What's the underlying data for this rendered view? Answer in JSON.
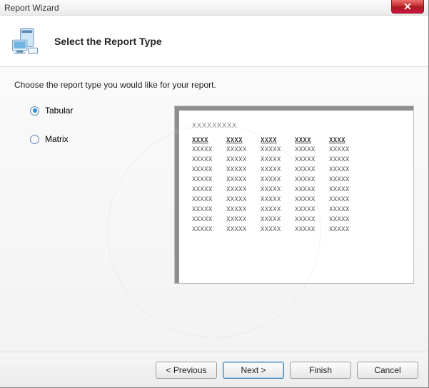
{
  "window": {
    "title": "Report Wizard"
  },
  "header": {
    "title": "Select the Report Type"
  },
  "content": {
    "prompt": "Choose the report type you would like for your report.",
    "options": {
      "tabular": "Tabular",
      "matrix": "Matrix",
      "selected": "tabular"
    },
    "preview": {
      "title": "XXXXXXXXX",
      "columns": [
        "XXXX",
        "XXXX",
        "XXXX",
        "XXXX",
        "XXXX"
      ],
      "cell": "XXXXX",
      "row_count": 9
    }
  },
  "footer": {
    "previous": "< Previous",
    "next": "Next >",
    "finish": "Finish",
    "cancel": "Cancel"
  }
}
